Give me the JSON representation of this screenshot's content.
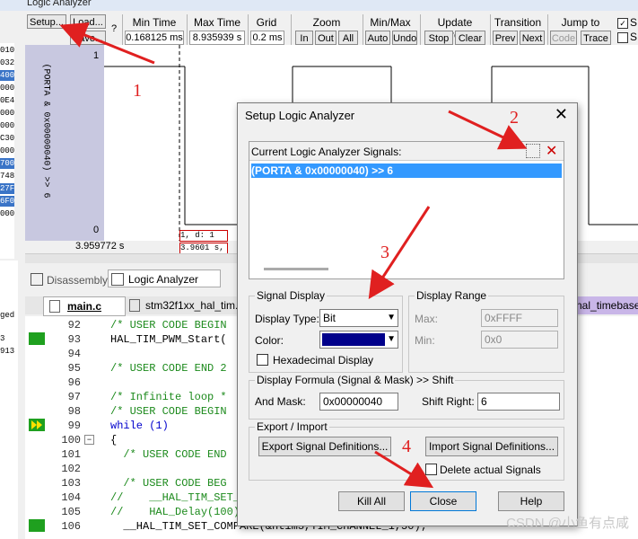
{
  "window": {
    "title": "Logic Analyzer"
  },
  "toolbar": {
    "setup": "Setup...",
    "load": "Load...",
    "save": "Save...",
    "help": "?",
    "min_time_label": "Min Time",
    "min_time_value": "0.168125 ms",
    "max_time_label": "Max Time",
    "max_time_value": "8.935939 s",
    "grid_label": "Grid",
    "grid_value": "0.2 ms",
    "zoom_label": "Zoom",
    "zoom_in": "In",
    "zoom_out": "Out",
    "zoom_all": "All",
    "minmax_label": "Min/Max",
    "minmax_auto": "Auto",
    "minmax_undo": "Undo",
    "update_label": "Update Screen",
    "update_stop": "Stop",
    "update_clear": "Clear",
    "transition_label": "Transition",
    "transition_prev": "Prev",
    "transition_next": "Next",
    "jump_label": "Jump to",
    "jump_code": "Code",
    "jump_trace": "Trace"
  },
  "left_hex": [
    "010",
    "032",
    "400",
    "000",
    "0E4",
    "000",
    "000",
    "C30",
    "000",
    "700",
    "748",
    "27F",
    "6F0",
    "000"
  ],
  "left_hex_selected": [
    2,
    9,
    11,
    12
  ],
  "left_words": [
    "ged",
    "3",
    "913"
  ],
  "waveform": {
    "signal_label": "(PORTA & 0x00000040) >> 6",
    "y_top": "1",
    "y_bottom": "0",
    "time_left": "3.959772 s",
    "cursor_line1": "1,   d: 1",
    "cursor_line2": "3.9601 s,"
  },
  "tabs": {
    "disassembly": "Disassembly",
    "logic_analyzer": "Logic Analyzer"
  },
  "code_tabs": {
    "main": "main.c",
    "hal_tim": "stm32f1xx_hal_tim.h",
    "timebase": "nal_timebase_"
  },
  "code_lines": [
    {
      "n": "92",
      "t": "/* USER CODE BEGIN",
      "cls": "cm"
    },
    {
      "n": "93",
      "t": "HAL_TIM_PWM_Start(",
      "cls": ""
    },
    {
      "n": "94",
      "t": "",
      "cls": ""
    },
    {
      "n": "95",
      "t": "/* USER CODE END 2",
      "cls": "cm"
    },
    {
      "n": "96",
      "t": "",
      "cls": ""
    },
    {
      "n": "97",
      "t": "/* Infinite loop *",
      "cls": "cm"
    },
    {
      "n": "98",
      "t": "/* USER CODE BEGIN",
      "cls": "cm"
    },
    {
      "n": "99",
      "t": "while (1)",
      "cls": "kw"
    },
    {
      "n": "100",
      "t": "{",
      "cls": ""
    },
    {
      "n": "101",
      "t": "  /* USER CODE END",
      "cls": "cm"
    },
    {
      "n": "102",
      "t": "",
      "cls": ""
    },
    {
      "n": "103",
      "t": "  /* USER CODE BEG",
      "cls": "cm"
    },
    {
      "n": "104",
      "t": "//    __HAL_TIM_SET_",
      "cls": "cm"
    },
    {
      "n": "105",
      "t": "//    HAL_Delay(100)",
      "cls": "cm"
    },
    {
      "n": "106",
      "t": "  __HAL_TIM_SET_COMPARE(&htim3,TIM_CHANNEL_1,50);",
      "cls": ""
    }
  ],
  "dialog": {
    "title": "Setup Logic Analyzer",
    "signals_label": "Current Logic Analyzer Signals:",
    "signals": [
      "(PORTA & 0x00000040) >> 6"
    ],
    "signal_display": {
      "label": "Signal Display",
      "display_type_label": "Display Type:",
      "display_type_value": "Bit",
      "color_label": "Color:",
      "color_value": "#00008b",
      "hex_label": "Hexadecimal Display"
    },
    "display_range": {
      "label": "Display Range",
      "max_label": "Max:",
      "max_value": "0xFFFF",
      "min_label": "Min:",
      "min_value": "0x0"
    },
    "formula": {
      "label": "Display Formula (Signal & Mask) >> Shift",
      "and_mask_label": "And Mask:",
      "and_mask_value": "0x00000040",
      "shift_right_label": "Shift Right:",
      "shift_right_value": "6"
    },
    "export_import": {
      "label": "Export / Import",
      "export_btn": "Export Signal Definitions...",
      "import_btn": "Import Signal Definitions...",
      "delete_label": "Delete actual Signals"
    },
    "kill_all": "Kill All",
    "close": "Close",
    "help": "Help"
  },
  "annotations": {
    "n1": "1",
    "n2": "2",
    "n3": "3",
    "n4": "4"
  },
  "watermark": "CSDN @小鱼有点咸",
  "colors": {
    "accent": "#0078d7",
    "signal_select": "#3399ff",
    "annotation": "#e02020"
  }
}
